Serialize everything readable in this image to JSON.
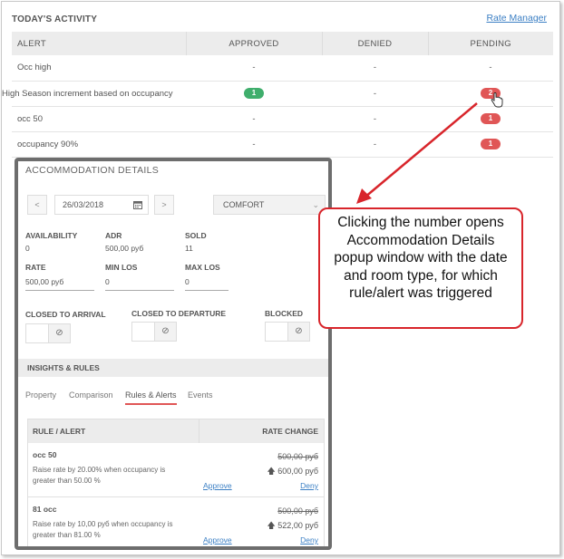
{
  "activity": {
    "title": "TODAY'S ACTIVITY",
    "rate_manager_link": "Rate Manager",
    "columns": [
      "ALERT",
      "APPROVED",
      "DENIED",
      "PENDING"
    ],
    "rows": [
      {
        "alert": "Occ high",
        "approved": "-",
        "denied": "-",
        "pending": "-"
      },
      {
        "alert": "High Season increment based on occupancy",
        "approved": "1",
        "denied": "-",
        "pending": "2"
      },
      {
        "alert": "occ 50",
        "approved": "-",
        "denied": "-",
        "pending": "1"
      },
      {
        "alert": "occupancy 90%",
        "approved": "-",
        "denied": "-",
        "pending": "1"
      }
    ],
    "colors": {
      "approved_badge": "#3fae6c",
      "pending_badge": "#e05656"
    }
  },
  "popup": {
    "title": "ACCOMMODATION DETAILS",
    "prev_label": "<",
    "next_label": ">",
    "date": "26/03/2018",
    "room_type": "COMFORT",
    "stats": {
      "availability_label": "AVAILABILITY",
      "availability_value": "0",
      "adr_label": "ADR",
      "adr_value": "500,00 руб",
      "sold_label": "SOLD",
      "sold_value": "11",
      "rate_label": "RATE",
      "rate_value": "500,00 руб",
      "min_los_label": "MIN LOS",
      "min_los_value": "0",
      "max_los_label": "MAX LOS",
      "max_los_value": "0"
    },
    "toggles": {
      "closed_to_arrival": "CLOSED TO ARRIVAL",
      "closed_to_departure": "CLOSED TO DEPARTURE",
      "blocked": "BLOCKED"
    },
    "insights_title": "INSIGHTS & RULES",
    "tabs": [
      "Property",
      "Comparison",
      "Rules & Alerts",
      "Events"
    ],
    "active_tab": "Rules & Alerts",
    "rules_header": {
      "rule": "RULE / ALERT",
      "rate_change": "RATE CHANGE"
    },
    "rules": [
      {
        "name": "occ 50",
        "description": "Raise rate by 20.00% when occupancy is greater than 50.00 %",
        "old_rate": "500,00 руб",
        "new_rate": "600,00 руб",
        "approve": "Approve",
        "deny": "Deny"
      },
      {
        "name": "81 occ",
        "description": "Raise rate by 10,00 руб when occupancy is greater than 81.00 %",
        "old_rate": "500,00 руб",
        "new_rate": "522,00 руб",
        "approve": "Approve",
        "deny": "Deny"
      }
    ]
  },
  "callout": {
    "text": "Clicking the number opens Accommodation Details popup window with the date and room type, for which rule/alert was triggered"
  }
}
